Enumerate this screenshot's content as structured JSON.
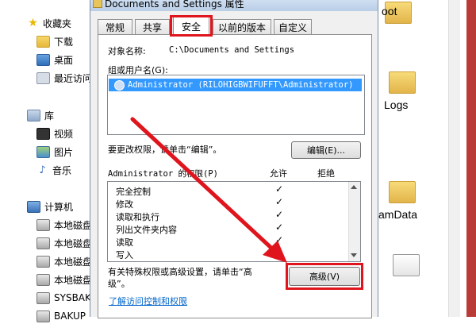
{
  "sidebar": {
    "favorites": {
      "label": "收藏夹",
      "items": [
        {
          "label": "下载",
          "icon": "folder-icon"
        },
        {
          "label": "桌面",
          "icon": "desktop-icon"
        },
        {
          "label": "最近访问",
          "icon": "recent-places-icon"
        }
      ]
    },
    "libraries": {
      "label": "库",
      "items": [
        {
          "label": "视频",
          "icon": "video-icon"
        },
        {
          "label": "图片",
          "icon": "pictures-icon"
        },
        {
          "label": "音乐",
          "icon": "music-icon"
        }
      ]
    },
    "computer": {
      "label": "计算机",
      "items": [
        {
          "label": "本地磁盘",
          "icon": "drive-icon"
        },
        {
          "label": "本地磁盘",
          "icon": "drive-icon"
        },
        {
          "label": "本地磁盘",
          "icon": "drive-icon"
        },
        {
          "label": "本地磁盘",
          "icon": "drive-icon"
        },
        {
          "label": "SYSBAK",
          "icon": "drive-icon"
        },
        {
          "label": "BAKUP",
          "icon": "drive-icon"
        }
      ]
    }
  },
  "background": {
    "item1": "oot",
    "item2": "Logs",
    "item3": "amData"
  },
  "dialog": {
    "title": "Documents and Settings 属性",
    "tabs": [
      "常规",
      "共享",
      "安全",
      "以前的版本",
      "自定义"
    ],
    "active_tab": "安全",
    "object_name_label": "对象名称:",
    "object_name_value": "C:\\Documents and Settings",
    "group_label": "组或用户名(G):",
    "users": [
      "Administrator (RILOHIGBWIFUFFT\\Administrator)"
    ],
    "change_text": "要更改权限，请单击“编辑”。",
    "edit_button": "编辑(E)...",
    "perm_header": "Administrator 的权限(P)",
    "allow_header": "允许",
    "deny_header": "拒绝",
    "permissions": [
      {
        "name": "完全控制",
        "allow": "✓"
      },
      {
        "name": "修改",
        "allow": "✓"
      },
      {
        "name": "读取和执行",
        "allow": "✓"
      },
      {
        "name": "列出文件夹内容",
        "allow": "✓"
      },
      {
        "name": "读取",
        "allow": "✓"
      },
      {
        "name": "写入",
        "allow": "✓"
      }
    ],
    "special_text_line1": "有关特殊权限或高级设置，请单击“高",
    "special_text_line2": "级”。",
    "advanced_button": "高级(V)",
    "learn_link": "了解访问控制和权限"
  },
  "colors": {
    "highlight_red": "#e0141c",
    "selection_blue": "#3399ff",
    "link_blue": "#0066cc"
  }
}
